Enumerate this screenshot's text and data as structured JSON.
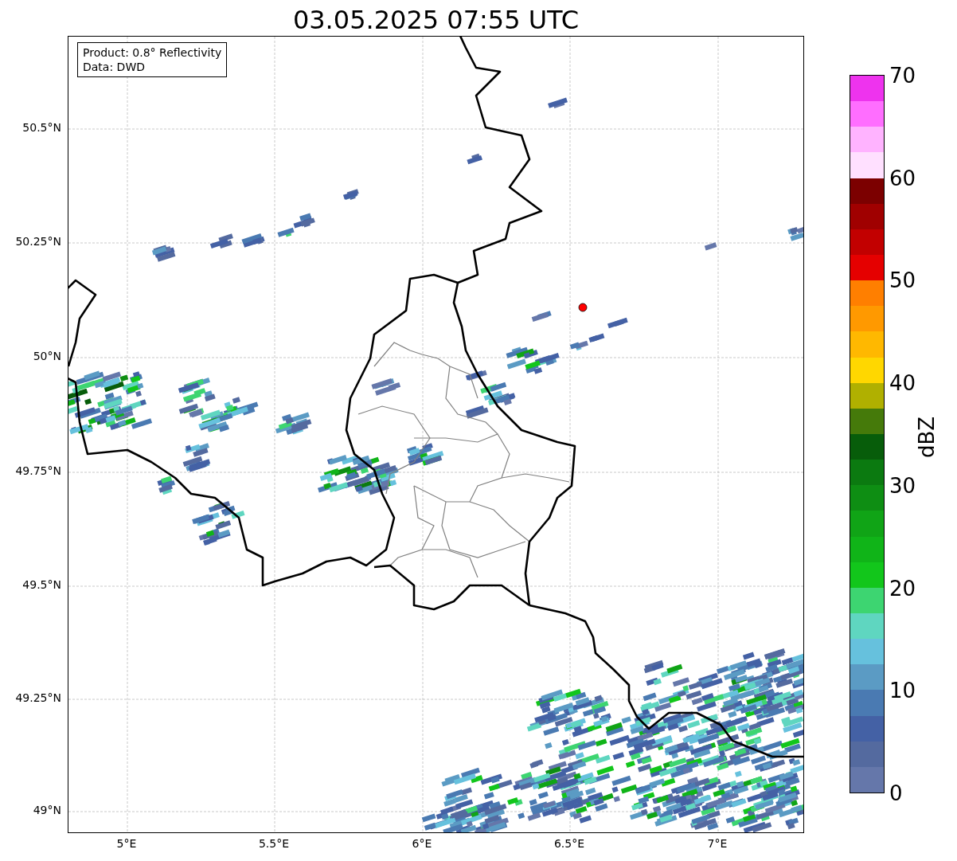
{
  "title": "03.05.2025 07:55 UTC",
  "info_box": [
    "Product: 0.8° Reflectivity",
    "Data: DWD"
  ],
  "x_ticks": [
    "5°E",
    "5.5°E",
    "6°E",
    "6.5°E",
    "7°E"
  ],
  "y_ticks": [
    "50.5°N",
    "50.25°N",
    "50°N",
    "49.75°N",
    "49.5°N",
    "49.25°N",
    "49°N"
  ],
  "colorbar": {
    "label": "dBZ",
    "ticks": [
      "70",
      "60",
      "50",
      "40",
      "30",
      "20",
      "10",
      "0"
    ],
    "bins": [
      {
        "color": "#6577aa"
      },
      {
        "color": "#546a9f"
      },
      {
        "color": "#4461a5"
      },
      {
        "color": "#4a7ab2"
      },
      {
        "color": "#5b9bc4"
      },
      {
        "color": "#66c1dd"
      },
      {
        "color": "#5fd6c0"
      },
      {
        "color": "#3dd571"
      },
      {
        "color": "#12c61b"
      },
      {
        "color": "#10b418"
      },
      {
        "color": "#10a416"
      },
      {
        "color": "#0e8e13"
      },
      {
        "color": "#0b7a10"
      },
      {
        "color": "#075d0a"
      },
      {
        "color": "#457a0a"
      },
      {
        "color": "#b0b000"
      },
      {
        "color": "#ffd700"
      },
      {
        "color": "#ffb800"
      },
      {
        "color": "#ff9900"
      },
      {
        "color": "#ff7f00"
      },
      {
        "color": "#e50000"
      },
      {
        "color": "#c20000"
      },
      {
        "color": "#a00000"
      },
      {
        "color": "#7c0000"
      },
      {
        "color": "#ffe0ff"
      },
      {
        "color": "#ffb3ff"
      },
      {
        "color": "#ff6eff"
      },
      {
        "color": "#ee33ee"
      }
    ]
  }
}
